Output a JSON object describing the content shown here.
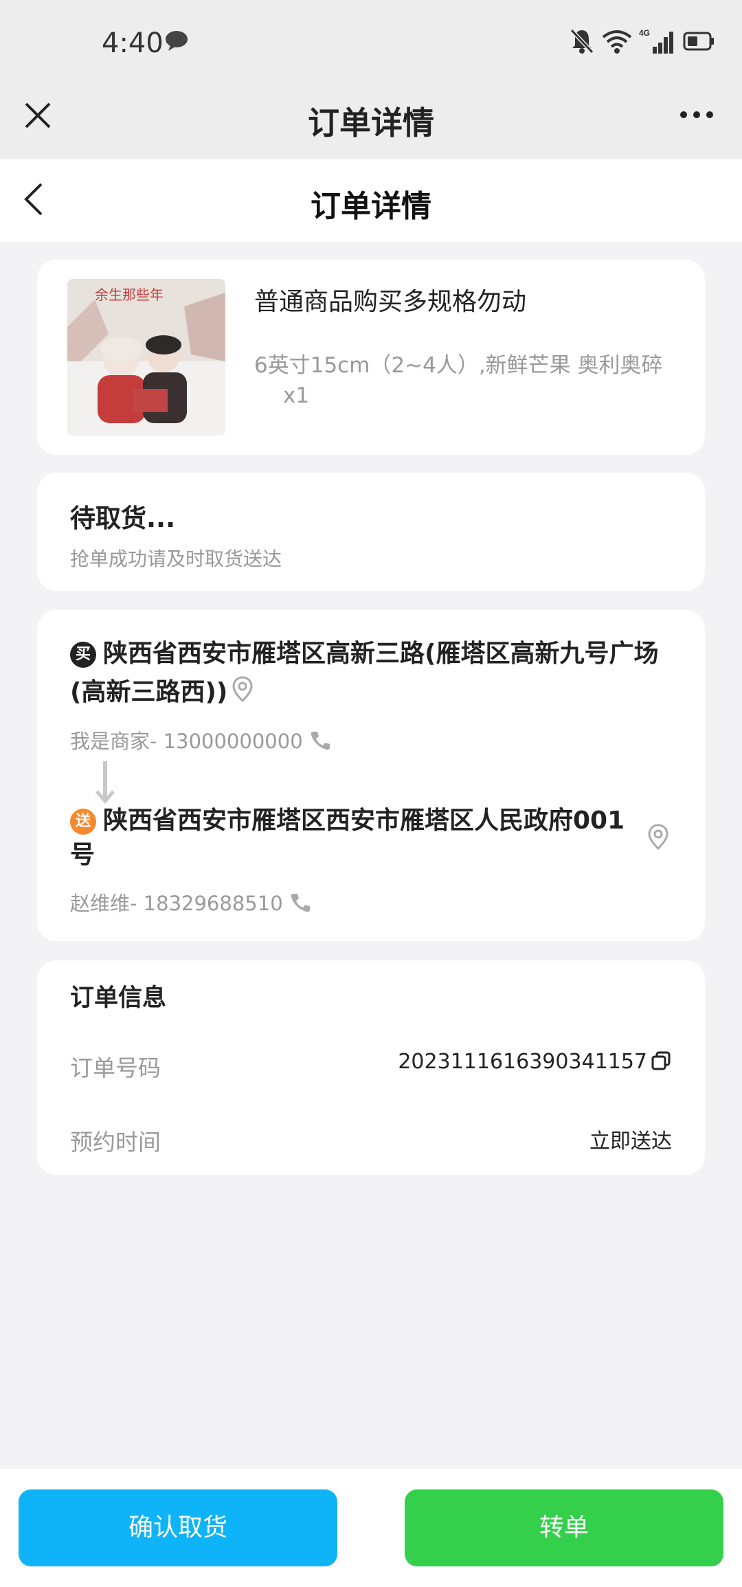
{
  "status_bar": {
    "time": "4:40",
    "icons": [
      "message-icon",
      "bell-mute-icon",
      "wifi-icon",
      "signal-4g-icon",
      "battery-icon"
    ],
    "network": "4G"
  },
  "webview": {
    "title": "订单详情"
  },
  "nav": {
    "title": "订单详情"
  },
  "product": {
    "image_text": "余生那些年",
    "name": "普通商品购买多规格勿动",
    "spec": "6英寸15cm（2~4人）,新鲜芒果 奥利奥碎",
    "qty": "x1"
  },
  "status": {
    "title": "待取货...",
    "desc": "抢单成功请及时取货送达"
  },
  "address": {
    "from_badge": "买",
    "from_address": "陕西省西安市雁塔区高新三路(雁塔区高新九号广场(高新三路西))",
    "from_contact": "我是商家- 13000000000",
    "to_badge": "送",
    "to_address": "陕西省西安市雁塔区西安市雁塔区人民政府001号",
    "to_contact": "赵维维- 18329688510"
  },
  "order_info": {
    "title": "订单信息",
    "order_no_label": "订单号码",
    "order_no_value": "2023111616390341157",
    "appointment_label": "预约时间",
    "appointment_value": "立即送达"
  },
  "actions": {
    "confirm_label": "确认取货",
    "transfer_label": "转单"
  },
  "colors": {
    "confirm_button": "#0eb3f8",
    "transfer_button": "#34d04b",
    "send_badge": "#f5892b"
  }
}
